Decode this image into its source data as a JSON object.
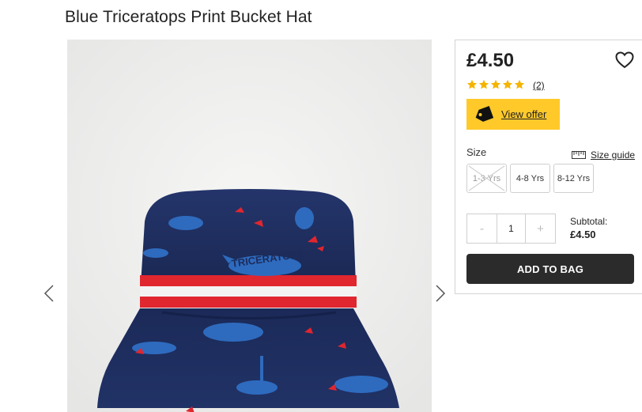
{
  "product": {
    "title": "Blue Triceratops Print Bucket Hat",
    "price": "£4.50",
    "rating_stars": 5,
    "reviews_count": "(2)",
    "offer_label": "View offer",
    "size_label": "Size",
    "size_guide_label": "Size guide",
    "sizes": [
      {
        "label": "1-3 Yrs",
        "available": false
      },
      {
        "label": "4-8 Yrs",
        "available": true
      },
      {
        "label": "8-12 Yrs",
        "available": true
      }
    ],
    "quantity": {
      "minus": "-",
      "value": "1",
      "plus": "+"
    },
    "subtotal_label": "Subtotal:",
    "subtotal_value": "£4.50",
    "add_to_bag_label": "ADD TO BAG"
  },
  "image": {
    "hat_print_text": "TRICERATOPS"
  },
  "colors": {
    "offer_yellow": "#ffc929",
    "star_gold": "#f5b400",
    "add_button": "#2b2b2b",
    "hat_navy": "#1d2b5a",
    "band_red": "#e0262f"
  },
  "icons": {
    "prev": "chevron-left-icon",
    "next": "chevron-right-icon",
    "wishlist": "heart-icon",
    "offer": "tag-icon",
    "size_guide": "ruler-icon"
  }
}
